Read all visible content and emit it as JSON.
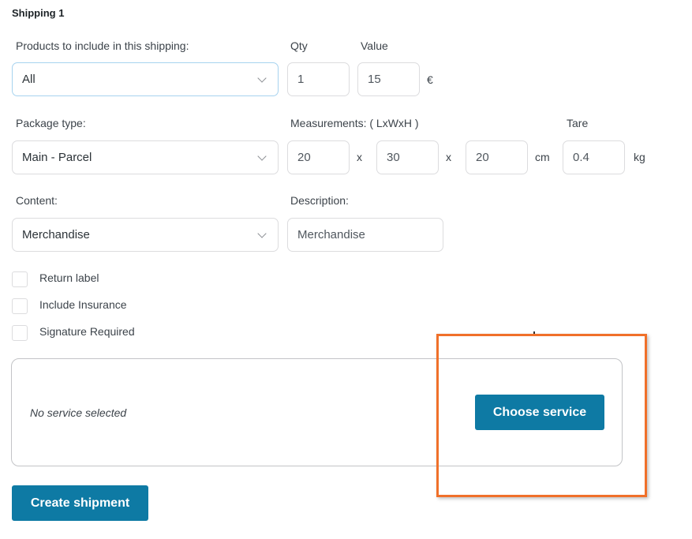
{
  "shipping": {
    "title": "Shipping 1",
    "products_label": "Products to include in this shipping:",
    "products_value": "All",
    "qty_label": "Qty",
    "qty_value": "1",
    "value_label": "Value",
    "value_value": "15",
    "currency": "€",
    "package_type_label": "Package type:",
    "package_type_value": "Main - Parcel",
    "measurements_label": "Measurements: ( LxWxH )",
    "length": "20",
    "width": "30",
    "height": "20",
    "separator": "x",
    "dimension_unit": "cm",
    "tare_label": "Tare",
    "tare_value": "0.4",
    "weight_unit": "kg",
    "content_label": "Content:",
    "content_value": "Merchandise",
    "description_label": "Description:",
    "description_value": "Merchandise"
  },
  "options": {
    "return_label": "Return label",
    "insurance": "Include Insurance",
    "signature": "Signature Required"
  },
  "service": {
    "status": "No service selected",
    "choose_button": "Choose service"
  },
  "actions": {
    "create_button": "Create shipment"
  },
  "colors": {
    "primary_button": "#0e7aa4",
    "highlight_border": "#f0702a",
    "focus_border": "#a7d3ef"
  }
}
